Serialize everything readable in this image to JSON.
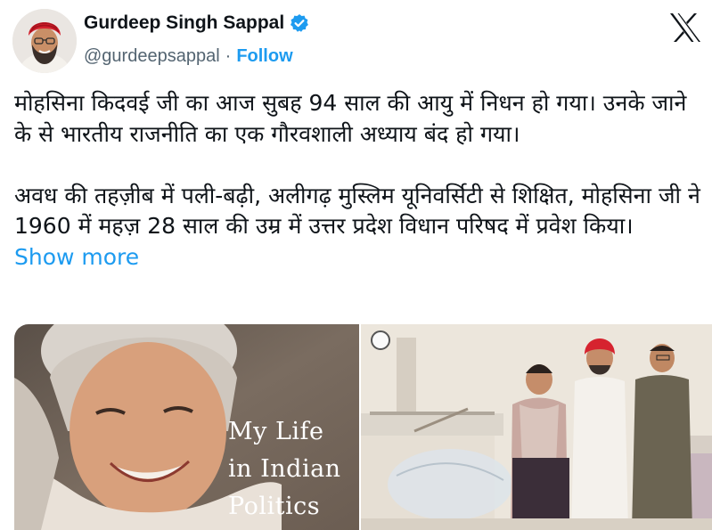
{
  "author": {
    "name": "Gurdeep Singh Sappal",
    "handle": "@gurdeepsappal",
    "separator": "·",
    "follow_label": "Follow",
    "verified": true
  },
  "brand": {
    "icon": "x-logo-icon",
    "color": "#0f1419"
  },
  "tweet": {
    "text": "मोहसिना किदवई जी का आज सुबह 94 साल की आयु में निधन हो गया। उनके जाने के से भारतीय राजनीति का एक गौरवशाली अध्याय बंद हो गया।\n\nअवध की तहज़ीब में पली-बढ़ी, अलीगढ़ मुस्लिम यूनिवर्सिटी से शिक्षित, मोहसिना जी ने 1960 में महज़ 28 साल की उम्र में उत्तर प्रदेश विधान परिषद में प्रवेश किया। ",
    "show_more_label": "Show more"
  },
  "media": {
    "book_cover_title": "My Life\nin Indian\nPolitics"
  },
  "colors": {
    "accent": "#1d9bf0",
    "secondary_text": "#536471",
    "primary_text": "#0f1419"
  }
}
